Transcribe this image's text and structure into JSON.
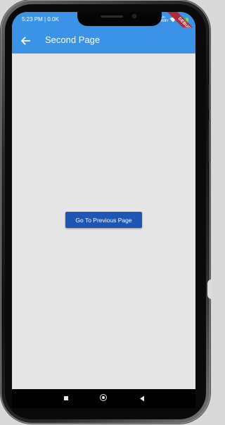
{
  "status_bar": {
    "time": "5:23 PM | 0.0K",
    "network_label": "Vo WiFi",
    "battery_label": "60"
  },
  "debug_banner": {
    "label": "DEBUG"
  },
  "app_bar": {
    "title": "Second Page",
    "back_icon": "arrow-left-icon"
  },
  "main": {
    "button_label": "Go To Previous Page"
  },
  "nav_bar": {
    "icons": [
      "recents-square-icon",
      "home-circle-icon",
      "back-triangle-icon"
    ]
  },
  "colors": {
    "app_bar": "#3a93e6",
    "button": "#1e56b5",
    "background": "#e5e5e5"
  }
}
